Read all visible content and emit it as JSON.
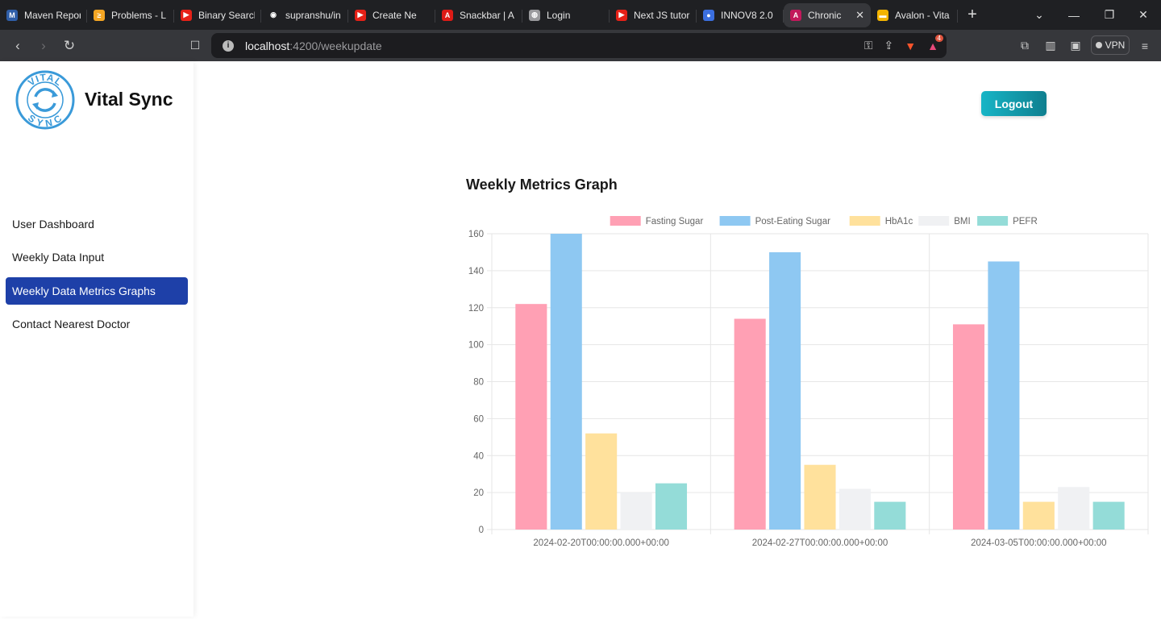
{
  "browser": {
    "tabs": [
      {
        "title": "Maven Repor",
        "color": "#2f5ea8",
        "glyph": "M"
      },
      {
        "title": "Problems - L",
        "color": "#f5a623",
        "glyph": "≥"
      },
      {
        "title": "Binary Search",
        "color": "#e62117",
        "glyph": "▶"
      },
      {
        "title": "supranshu/in",
        "color": "#ffffff",
        "glyph": "◉"
      },
      {
        "title": "Create Ne",
        "color": "#e62117",
        "glyph": "▶"
      },
      {
        "title": "Snackbar | A",
        "color": "#dd1b16",
        "glyph": "A"
      },
      {
        "title": "Login",
        "color": "#9a9a9d",
        "glyph": "◍"
      },
      {
        "title": "Next JS tutor",
        "color": "#e62117",
        "glyph": "▶"
      },
      {
        "title": "INNOV8 2.0",
        "color": "#3b6fe0",
        "glyph": "●"
      },
      {
        "title": "Chronic",
        "color": "#c2185b",
        "glyph": "A",
        "active": true
      },
      {
        "title": "Avalon - Vita",
        "color": "#f4b400",
        "glyph": "▬"
      }
    ],
    "url_host": "localhost",
    "url_path": ":4200/weekupdate",
    "vpn_label": "VPN",
    "brave_badge": "4"
  },
  "sidebar": {
    "brand": "Vital Sync",
    "logo_text_top": "VITAL",
    "logo_text_bottom": "SYNC",
    "items": [
      {
        "label": "User Dashboard",
        "active": false
      },
      {
        "label": "Weekly Data Input",
        "active": false
      },
      {
        "label": "Weekly Data Metrics Graphs",
        "active": true
      },
      {
        "label": "Contact Nearest Doctor",
        "active": false
      }
    ]
  },
  "header": {
    "logout_label": "Logout"
  },
  "main": {
    "title": "Weekly Metrics Graph"
  },
  "colors": {
    "accent_nav": "#1e40a8",
    "logout_start": "#17b5c6",
    "logout_end": "#0f7f8f"
  },
  "chart_data": {
    "type": "bar",
    "categories": [
      "2024-02-20T00:00:00.000+00:00",
      "2024-02-27T00:00:00.000+00:00",
      "2024-03-05T00:00:00.000+00:00"
    ],
    "series": [
      {
        "name": "Fasting Sugar",
        "values": [
          122,
          114,
          111
        ],
        "fill": "#ffa0b4",
        "stroke": "#ff6b8c"
      },
      {
        "name": "Post-Eating Sugar",
        "values": [
          160,
          150,
          145
        ],
        "fill": "#8ec8f2",
        "stroke": "#4aa3e8"
      },
      {
        "name": "HbA1c",
        "values": [
          52,
          35,
          15
        ],
        "fill": "#ffe19c",
        "stroke": "#ffcc55"
      },
      {
        "name": "BMI",
        "values": [
          20,
          22,
          23
        ],
        "fill": "#f0f1f3",
        "stroke": "#dfe1e4"
      },
      {
        "name": "PEFR",
        "values": [
          25,
          15,
          15
        ],
        "fill": "#94dcd8",
        "stroke": "#5cc6c0"
      }
    ],
    "yticks": [
      0,
      20,
      40,
      60,
      80,
      100,
      120,
      140,
      160
    ],
    "ylim": [
      0,
      160
    ],
    "grid": true,
    "legend": "top-center"
  }
}
